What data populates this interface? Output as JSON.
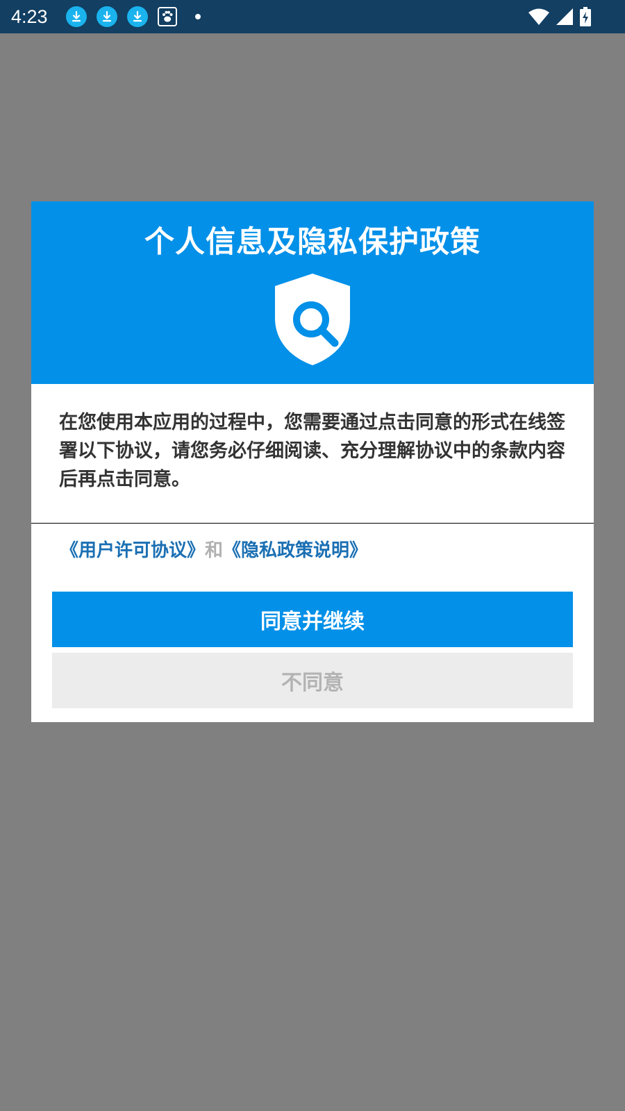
{
  "status_bar": {
    "time": "4:23"
  },
  "dialog": {
    "title": "个人信息及隐私保护政策",
    "body": "在您使用本应用的过程中，您需要通过点击同意的形式在线签署以下协议，请您务必仔细阅读、充分理解协议中的条款内容后再点击同意。",
    "links": {
      "user_agreement": "《用户许可协议》",
      "separator": "和",
      "privacy_policy": "《隐私政策说明》"
    },
    "agree_button": "同意并继续",
    "disagree_button": "不同意"
  },
  "colors": {
    "status_bar": "#123f62",
    "header": "#0390e8",
    "link": "#1a6fb3",
    "overlay": "#808080"
  }
}
